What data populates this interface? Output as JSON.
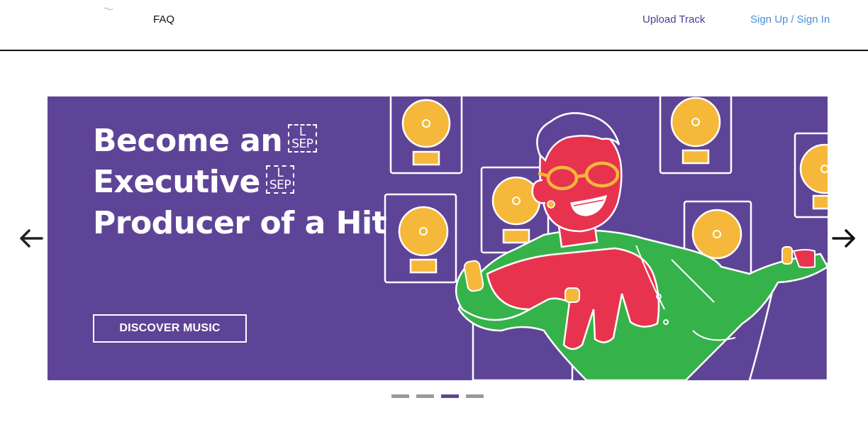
{
  "nav": {
    "faq": "FAQ",
    "upload": "Upload Track",
    "sign_up": "Sign Up",
    "separator": "/",
    "sign_in": "Sign In"
  },
  "hero": {
    "line1": "Become an",
    "line2": "Executive",
    "line3": "Producer of a Hit",
    "sep_top": "L",
    "sep_bottom": "SEP",
    "cta": "DISCOVER MUSIC",
    "bg_color": "#5e4497"
  },
  "carousel": {
    "slide_count": 4,
    "active_index": 2,
    "prev_icon": "arrow-left-icon",
    "next_icon": "arrow-right-icon"
  },
  "colors": {
    "accent_purple": "#5e4497",
    "link_blue": "#4a8fd6",
    "record_gold": "#f5b83a",
    "skin_red": "#e8334f",
    "shirt_green": "#36b24a"
  }
}
